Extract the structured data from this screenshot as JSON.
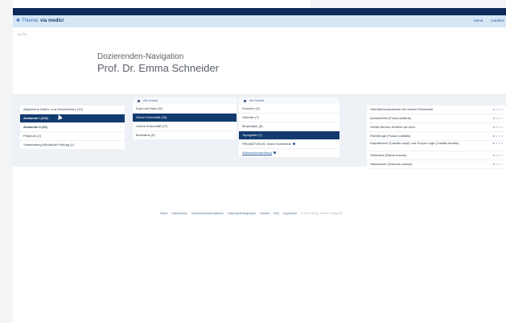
{
  "app": {
    "brand_thieme": "Thieme",
    "brand_product": "via medici"
  },
  "navbar": {
    "menu": "Menü",
    "user": "Caroline"
  },
  "search": {
    "label": "Suche"
  },
  "heading": {
    "line1": "Dozierenden-Navigation",
    "line2": "Prof. Dr. Emma Schneider"
  },
  "col1": {
    "items": [
      "Allgemeine Zellen- und Gewebelehre (12)",
      "Anatomie I (113)",
      "Anatomie II (24)",
      "Präpkurs (2)",
      "Vorbereitung Mündliche Prüfung (1)"
    ]
  },
  "col2": {
    "header": "Alle Module",
    "items": [
      "Kopf und Hals (41)",
      "Obere Extremität (36)",
      "Untere Extremität (27)",
      "Brustsitus (9)"
    ]
  },
  "col3": {
    "header": "Alle Module",
    "items": [
      "Knochen (3)",
      "Gelenke (7)",
      "Muskulatur (8)",
      "Topografie (7)",
      "PROMETHEUS: Obere Extremität",
      "Wissensüberprüfung"
    ]
  },
  "col4": {
    "items": [
      "Oberflächenanatomie der oberen Extremität",
      "Achselhöhle (Fossa axillaris)",
      "Gefäß-Nerven-Straßen am Arm",
      "Ellenbeuge (Fossa cubitalis)",
      "Karpaltunnel (Canalis carpi) und Guyon-Loge (Canalis ulnaris)",
      "Hohlhand (Palma manus)",
      "Handrücken (Dorsum manus)"
    ]
  },
  "footer": {
    "links": [
      "Home",
      "Datenschutz",
      "Verbraucherinformationen",
      "Nutzungsbedingungen",
      "Kontakt",
      "FAQ",
      "Impressum"
    ],
    "copyright": "© 2021 Georg Thieme Verlag KG"
  },
  "colors": {
    "topbar": "#0b2a57",
    "navbar": "#d6e6f5",
    "selected": "#123a6e"
  }
}
